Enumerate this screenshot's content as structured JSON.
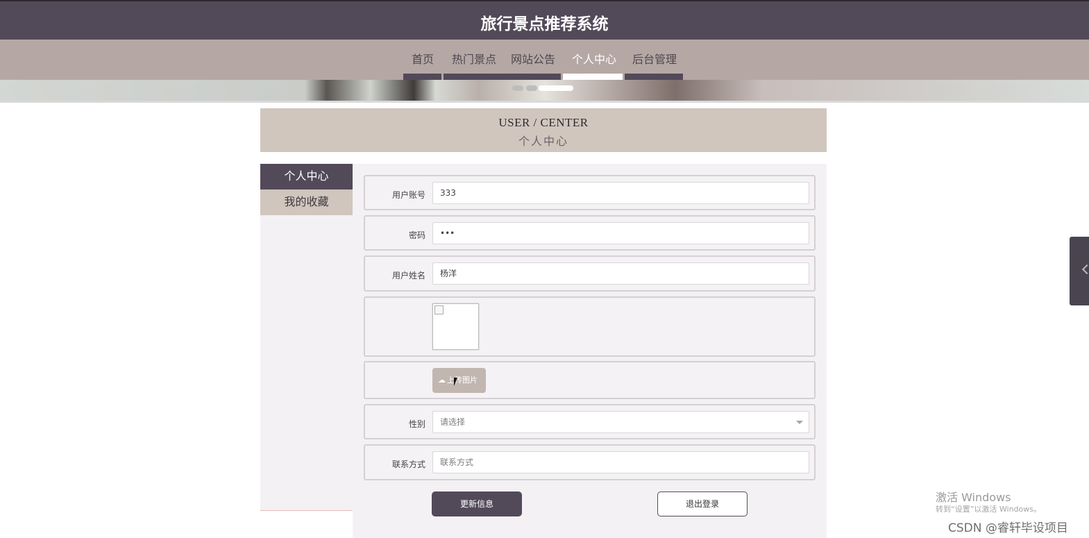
{
  "site": {
    "title": "旅行景点推荐系统"
  },
  "nav": {
    "items": [
      {
        "label": "首页",
        "active": false
      },
      {
        "label": "热门景点",
        "active": false
      },
      {
        "label": "网站公告",
        "active": false
      },
      {
        "label": "个人中心",
        "active": true
      },
      {
        "label": "后台管理",
        "active": false
      }
    ]
  },
  "banner": {
    "dot_count": 3,
    "active_dot": 3
  },
  "header": {
    "en_title": "USER / CENTER",
    "cn_title": "个人中心"
  },
  "sidebar": {
    "items": [
      {
        "label": "个人中心",
        "active": true
      },
      {
        "label": "我的收藏",
        "active": false
      }
    ]
  },
  "form": {
    "account": {
      "label": "用户账号",
      "value": "333"
    },
    "password": {
      "label": "密码",
      "value": "•••"
    },
    "name": {
      "label": "用户姓名",
      "value": "杨洋"
    },
    "avatar": {
      "label": "",
      "icon": "broken-image-icon"
    },
    "upload": {
      "label": "上传图片",
      "icon": "cloud-upload-icon"
    },
    "gender": {
      "label": "性别",
      "placeholder": "请选择"
    },
    "contact": {
      "label": "联系方式",
      "placeholder": "联系方式"
    }
  },
  "buttons": {
    "update": "更新信息",
    "logout": "退出登录"
  },
  "watermark": {
    "line1": "激活 Windows",
    "line2": "转到“设置”以激活 Windows。",
    "credit": "CSDN @睿轩毕设项目"
  },
  "colors": {
    "primary": "#524a59",
    "nav_bg": "#b5a8a4",
    "header_bg": "#d0c6be",
    "panel_bg": "#f3f1f4"
  }
}
